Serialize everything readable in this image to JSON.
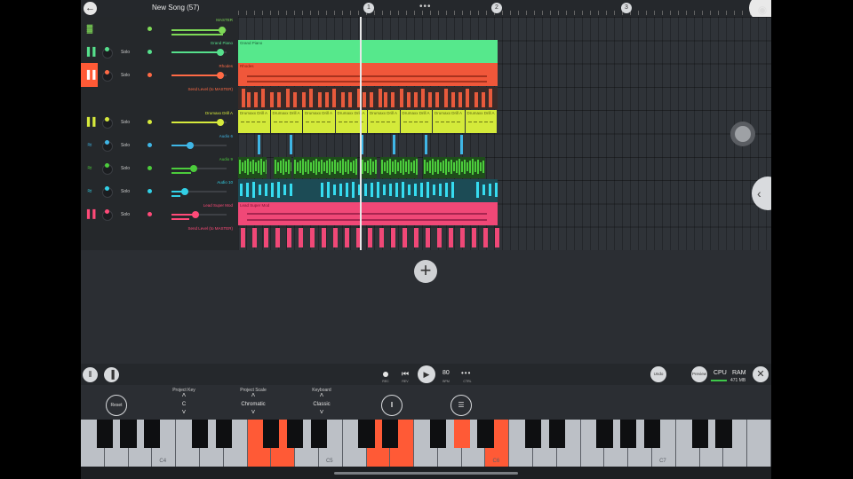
{
  "app": {
    "song_title": "New Song (57)",
    "markers": [
      "1",
      "2",
      "3"
    ],
    "more_label": "•••"
  },
  "tracks": [
    {
      "name": "MASTER",
      "color": "#7ed957",
      "solo": "",
      "icon": "bars-icon"
    },
    {
      "name": "Grand Piano",
      "color": "#56e08c",
      "solo": "Solo",
      "icon": "piano-icon"
    },
    {
      "name": "Rhodes",
      "color": "#ff6a45",
      "solo": "Solo",
      "icon": "piano-icon",
      "send": "Send Level (to MASTER)"
    },
    {
      "name": "Drumaxx Drill A",
      "color": "#d7ea3c",
      "solo": "Solo",
      "icon": "drum-icon"
    },
    {
      "name": "Audio 6",
      "color": "#3fb6e6",
      "solo": "Solo",
      "icon": "waveform-icon"
    },
    {
      "name": "Audio 9",
      "color": "#4ccc3c",
      "solo": "Solo",
      "icon": "waveform-icon"
    },
    {
      "name": "Audio 10",
      "color": "#32d0e6",
      "solo": "Solo",
      "icon": "waveform-icon"
    },
    {
      "name": "Lead Super Mod",
      "color": "#ff4a78",
      "solo": "Solo",
      "icon": "piano-icon",
      "send": "Send Level (to MASTER)"
    }
  ],
  "clips": {
    "grand_piano": "Grand Piano",
    "rhodes": "Rhodes",
    "drum": "Drumaxx Drill A",
    "lead": "Lead Super Mod"
  },
  "transport": {
    "rec_label": "REC",
    "rev_label": "REV",
    "bpm": "80",
    "bpm_label": "BPM",
    "ctrl_label": "CTRL",
    "undo": "Undo",
    "preview": "Preview",
    "cpu": "CPU",
    "ram": "RAM",
    "ram_value": "471 MB"
  },
  "keyboard_controls": {
    "reset": "Reset",
    "project_key_title": "Project Key",
    "project_key_value": "C",
    "project_scale_title": "Project Scale",
    "project_scale_value": "Chromatic",
    "keyboard_title": "Keyboard",
    "keyboard_value": "Classic"
  },
  "octave_labels": [
    "C4",
    "C5",
    "C6",
    "C7"
  ],
  "colors": {
    "accent_orange": "#ff5a36",
    "background": "#2b2e33"
  }
}
